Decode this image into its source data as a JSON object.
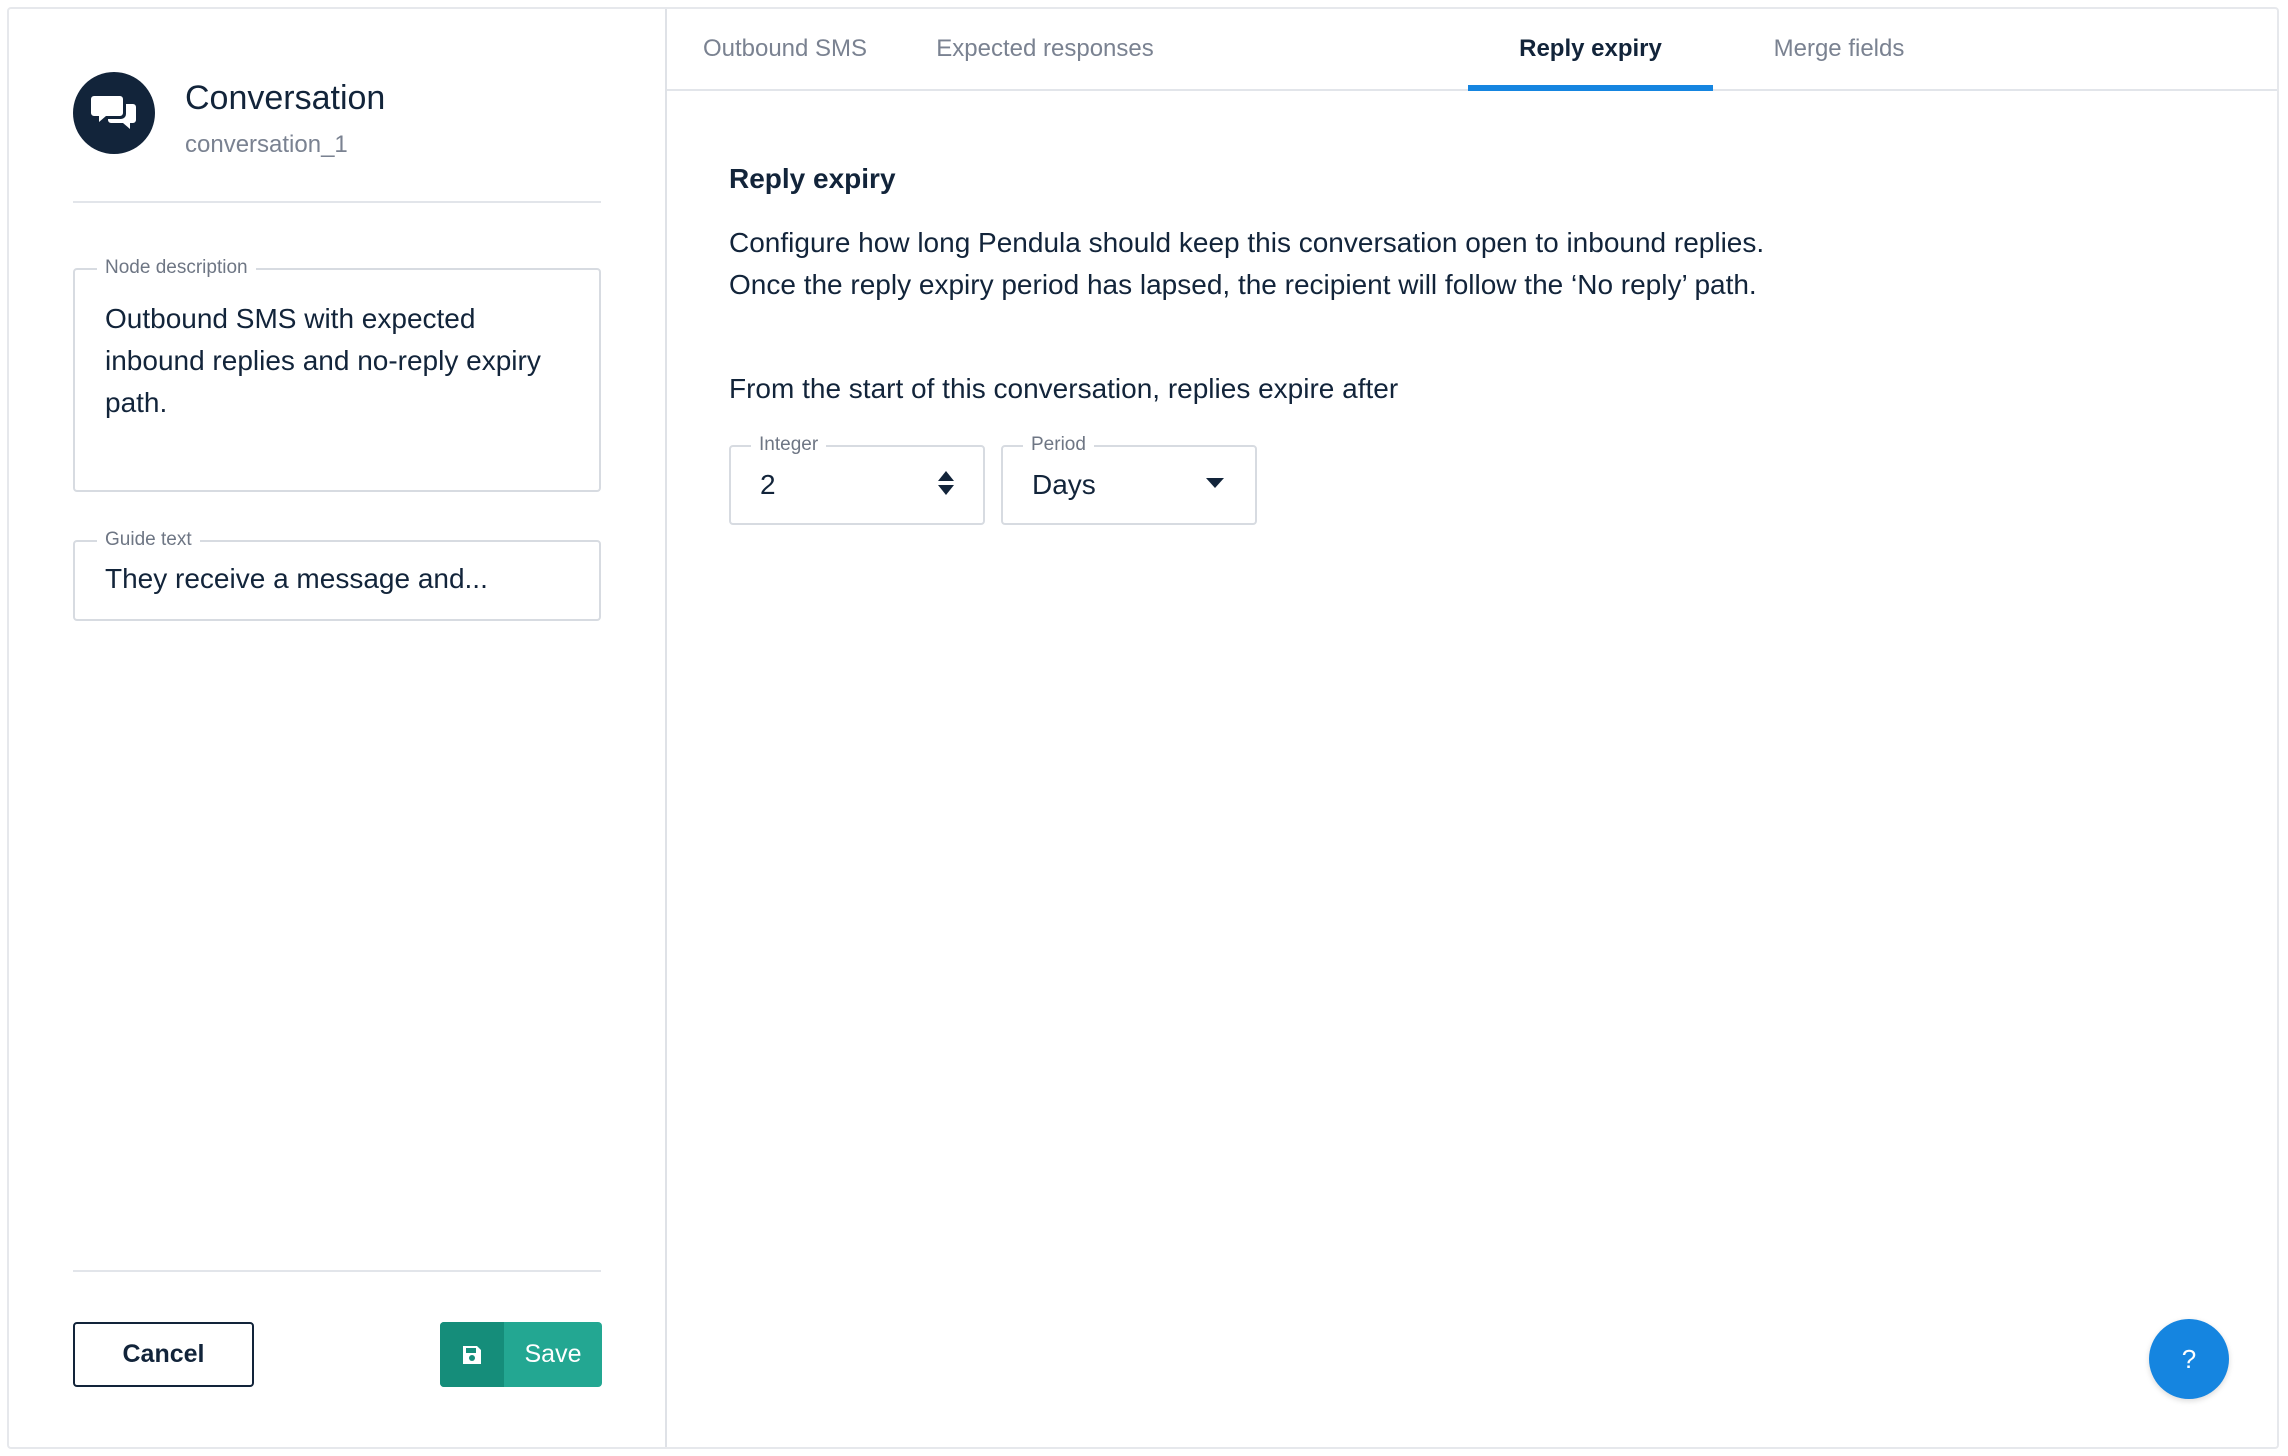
{
  "node": {
    "title": "Conversation",
    "id": "conversation_1",
    "icon": "chat-bubbles-icon"
  },
  "description_field": {
    "label": "Node description",
    "value": "Outbound SMS with expected inbound replies and no-reply expiry path."
  },
  "guide_field": {
    "label": "Guide text",
    "value": "They receive a message and..."
  },
  "actions": {
    "cancel_label": "Cancel",
    "save_label": "Save"
  },
  "tabs": [
    {
      "label": "Outbound SMS",
      "active": false
    },
    {
      "label": "Expected responses",
      "active": false
    },
    {
      "label": "Reply expiry",
      "active": true
    },
    {
      "label": "Merge fields",
      "active": false
    }
  ],
  "reply_expiry": {
    "title": "Reply expiry",
    "description_line1": "Configure how long Pendula should keep this conversation open to inbound replies.",
    "description_line2": "Once the reply expiry period has lapsed, the recipient will follow the ‘No reply’ path.",
    "prompt": "From the start of this conversation, replies expire after",
    "integer": {
      "label": "Integer",
      "value": "2"
    },
    "period": {
      "label": "Period",
      "value": "Days"
    }
  },
  "help": {
    "label": "?"
  },
  "colors": {
    "navy": "#12243a",
    "accent_blue": "#1585e0",
    "save_green": "#23a792",
    "save_green_dark": "#158d7a"
  }
}
